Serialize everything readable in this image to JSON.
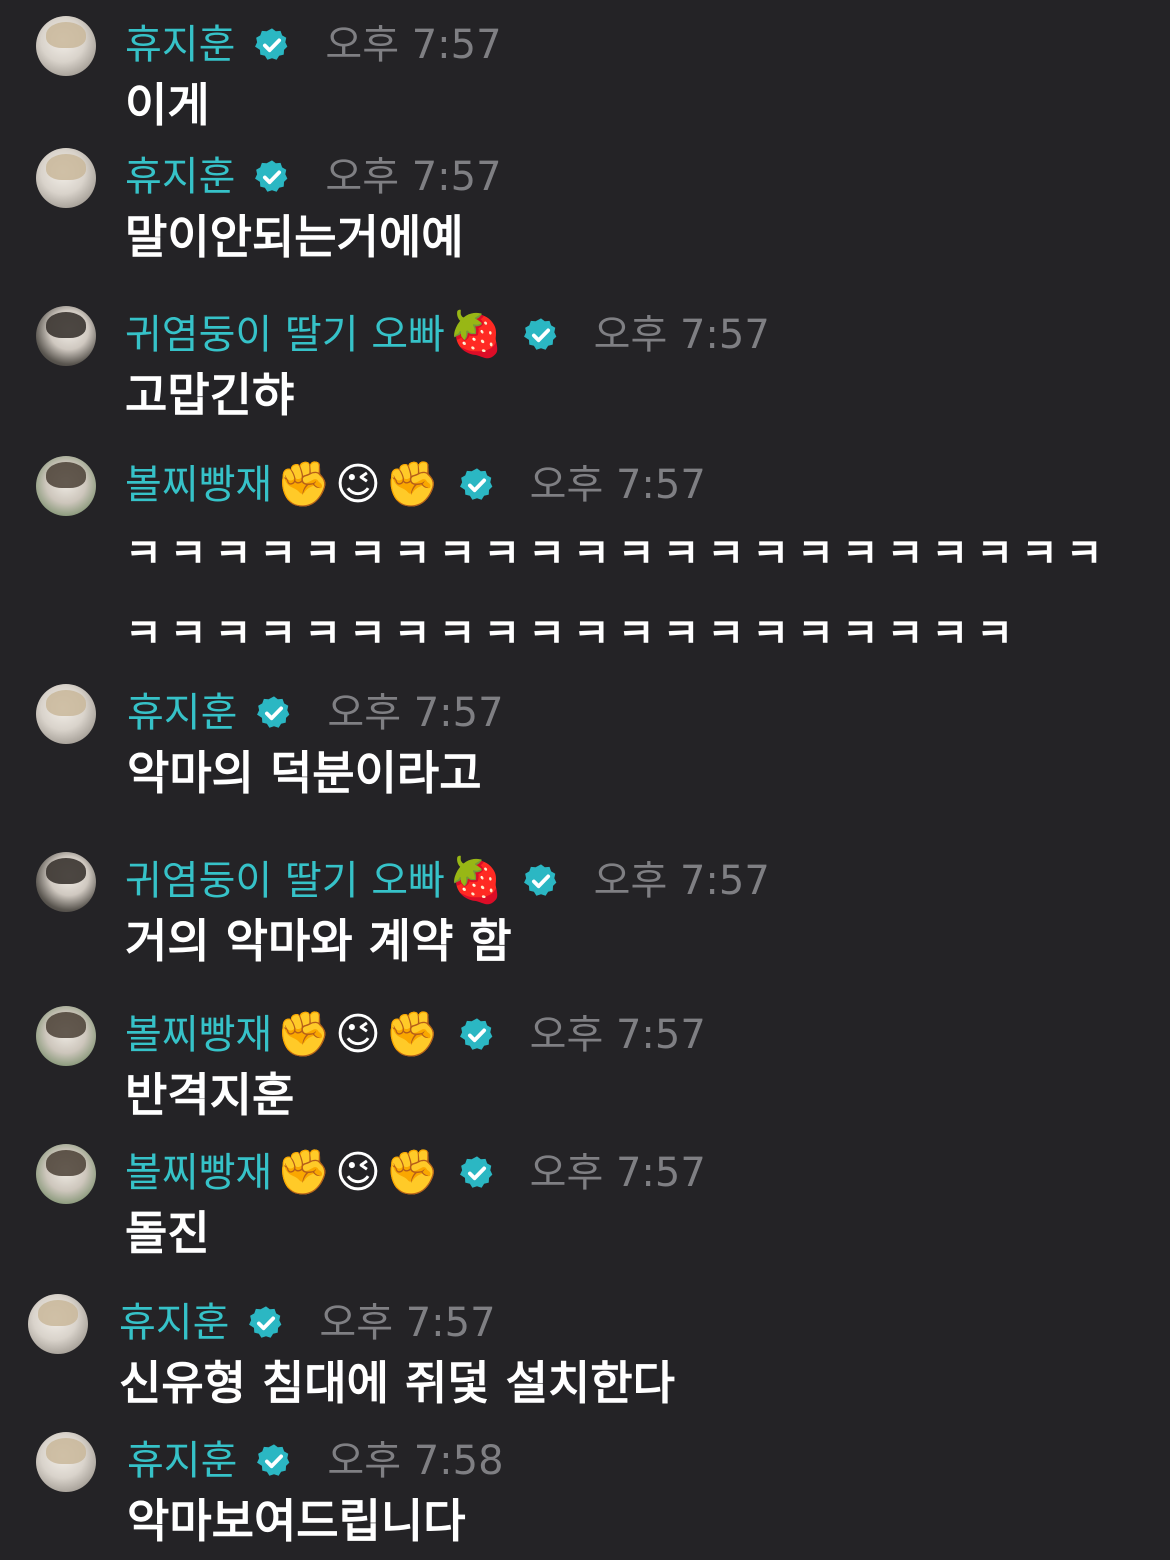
{
  "colors": {
    "background": "#242326",
    "username": "#36c2c8",
    "timestamp": "#7f7f83",
    "message": "#ffffff",
    "verified_badge": "#2bb7c3"
  },
  "messages": [
    {
      "user": "휴지훈",
      "emoji": [],
      "time": "오후 7:57",
      "lines": [
        "이게"
      ]
    },
    {
      "user": "휴지훈",
      "emoji": [],
      "time": "오후 7:57",
      "lines": [
        "말이안되는거에예"
      ]
    },
    {
      "user": "귀염둥이 딸기 오빠",
      "emoji": [
        "🍓"
      ],
      "time": "오후 7:57",
      "lines": [
        "고맙긴햐"
      ]
    },
    {
      "user": "볼찌빵재",
      "emoji": [
        "✊",
        "😉",
        "✊"
      ],
      "time": "오후 7:57",
      "lines": [
        "ㅋㅋㅋㅋㅋㅋㅋㅋㅋㅋㅋㅋㅋㅋㅋㅋㅋㅋㅋㅋㅋㅋ",
        "ㅋㅋㅋㅋㅋㅋㅋㅋㅋㅋㅋㅋㅋㅋㅋㅋㅋㅋㅋㅋ"
      ]
    },
    {
      "user": "휴지훈",
      "emoji": [],
      "time": "오후 7:57",
      "lines": [
        "악마의 덕분이라고"
      ]
    },
    {
      "user": "귀염둥이 딸기 오빠",
      "emoji": [
        "🍓"
      ],
      "time": "오후 7:57",
      "lines": [
        "거의 악마와 계약 함"
      ]
    },
    {
      "user": "볼찌빵재",
      "emoji": [
        "✊",
        "😉",
        "✊"
      ],
      "time": "오후 7:57",
      "lines": [
        "반격지훈"
      ]
    },
    {
      "user": "볼찌빵재",
      "emoji": [
        "✊",
        "😉",
        "✊"
      ],
      "time": "오후 7:57",
      "lines": [
        "돌진"
      ]
    },
    {
      "user": "휴지훈",
      "emoji": [],
      "time": "오후 7:57",
      "lines": [
        "신유형 침대에 쥐덫 설치한다"
      ]
    },
    {
      "user": "휴지훈",
      "emoji": [],
      "time": "오후 7:58",
      "lines": [
        "악마보여드립니다"
      ]
    }
  ]
}
